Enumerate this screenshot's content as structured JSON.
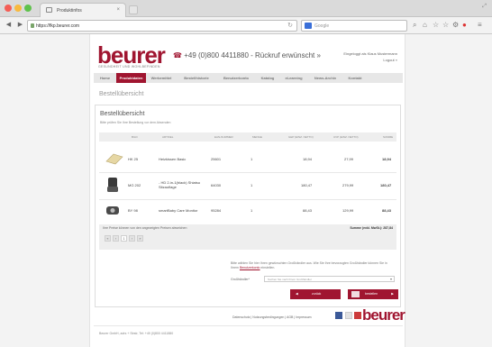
{
  "browser": {
    "tab_title": "Produktinfos",
    "tab_close": "×",
    "url": "https://fkp.beurer.com",
    "search_placeholder": "Google"
  },
  "header": {
    "logo": "beurer",
    "tagline": "GESUNDHEIT UND WOHLBEFINDEN",
    "phone_text": "+49 (0)800 4411880 - Rückruf erwünscht »",
    "login_line1": "Eingeloggt als Klaus Mustermann",
    "login_line2": "Logout »"
  },
  "nav": [
    {
      "label": "Home"
    },
    {
      "label": "Produktdaten"
    },
    {
      "label": "Werbemittel"
    },
    {
      "label": "Bestellhistorie"
    },
    {
      "label": "Benutzerkonto"
    },
    {
      "label": "Katalog"
    },
    {
      "label": "eLearning"
    },
    {
      "label": "News-Archiv"
    },
    {
      "label": "Kontakt"
    }
  ],
  "colors": {
    "brand": "#a01530"
  },
  "page_heading": "Bestellübersicht",
  "panel": {
    "title": "Bestellübersicht",
    "subtitle": "Bitte prüfen Sie Ihre Bestellung vor dem Absenden",
    "headers": [
      "BILD",
      "ARTIKEL",
      "BEZEICHNUNG",
      "EAN-NUMMER",
      "MENGE",
      "GEP (EINZ. NETTO)",
      "UVP (EINZ. NETTO)",
      "SUMME"
    ],
    "rows": [
      {
        "artikel": "HK 25",
        "bezeichnung": "Heizkissen Basic",
        "ean": "25601",
        "menge": "1",
        "gep": "18,94",
        "uvp": "27,99",
        "summe": "18,94",
        "icon": "heating-pad-icon"
      },
      {
        "artikel": "MG 202",
        "bezeichnung": "- HD 2-in-1(black) Shiatsu Sitzauflage",
        "ean": "64030",
        "menge": "1",
        "gep": "180,47",
        "uvp": "279,99",
        "summe": "180,47",
        "icon": "massage-seat-icon"
      },
      {
        "artikel": "BY 98",
        "bezeichnung": "smartBaby Care Monitor",
        "ean": "95284",
        "menge": "1",
        "gep": "88,43",
        "uvp": "129,99",
        "summe": "88,43",
        "icon": "baby-monitor-icon"
      }
    ],
    "price_note": "Ihre Preise können von den angezeigten Preisen abweichen",
    "total": "Summe (exkl. MwSt.): 287,84",
    "pagination": [
      "«",
      "‹",
      "1",
      "›",
      "»"
    ],
    "hint_text": "Bitte wählen Sie hier Ihren gewünschten Großhändler aus. Wie Sie Ihre bevorzugten Großhändler können Sie in Ihrem",
    "hint_link": "Benutzerkonto",
    "hint_tail": "einstellen.",
    "dealer_label": "Großhändler*",
    "dealer_placeholder": "Suchen Sie nach Ihrem Großhändler",
    "back_label": "zurück",
    "order_label": "bestellen"
  },
  "footer": {
    "links": "Datenschutz | Nutzungsbedingungen | AGB | Impressum",
    "logo": "beurer",
    "address": "Beurer GmbH, adrs + Strstr, Tel: +49 (0)800 4411880"
  }
}
